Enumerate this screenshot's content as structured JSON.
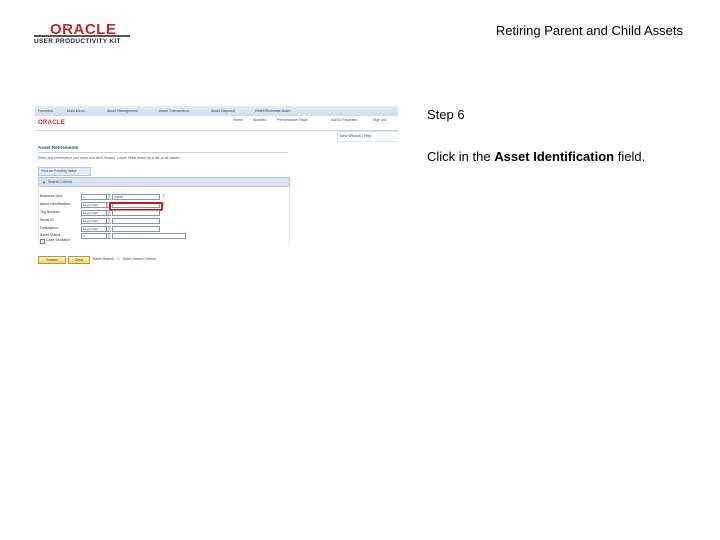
{
  "header": {
    "logo_brand": "ORACLE",
    "logo_sub": "USER PRODUCTIVITY KIT",
    "title": "Retiring Parent and Child Assets"
  },
  "step": {
    "label": "Step 6",
    "instruction_prefix": "Click in the ",
    "instruction_target": "Asset Identification",
    "instruction_suffix": " field."
  },
  "screenshot": {
    "breadcrumbs": [
      "Favorites",
      "Main Menu",
      "Asset Management",
      "Asset Transactions",
      "Asset Disposal",
      "Retire/Reinstate Asset"
    ],
    "brand": "ORACLE",
    "menu_links": [
      "Home",
      "Worklist",
      "Performance Trace",
      "Add to Favorites",
      "Sign out"
    ],
    "subnav": "New Window | Help",
    "page_title": "Asset Retirements",
    "page_description": "Enter any information you have and click Search. Leave fields blank for a list of all values.",
    "tab_label": "Find an Existing Value",
    "section_label": "Search Criteria",
    "fields": [
      {
        "label": "Business Unit:",
        "op": "=",
        "value": "US001",
        "search": true
      },
      {
        "label": "Asset Identification:",
        "op": "begins with",
        "value": "",
        "search": true
      },
      {
        "label": "Tag Number:",
        "op": "begins with",
        "value": "",
        "search": false
      },
      {
        "label": "Serial ID:",
        "op": "begins with",
        "value": "",
        "search": false
      },
      {
        "label": "Description:",
        "op": "begins with",
        "value": "",
        "search": false
      },
      {
        "label": "Asset Status:",
        "op": "=",
        "value": "",
        "search": false
      }
    ],
    "case_sensitive": "Case Sensitive",
    "search_button": "Search",
    "clear_button": "Clear",
    "basic_search": "Basic Search",
    "save_search": "Save Search Criteria"
  }
}
